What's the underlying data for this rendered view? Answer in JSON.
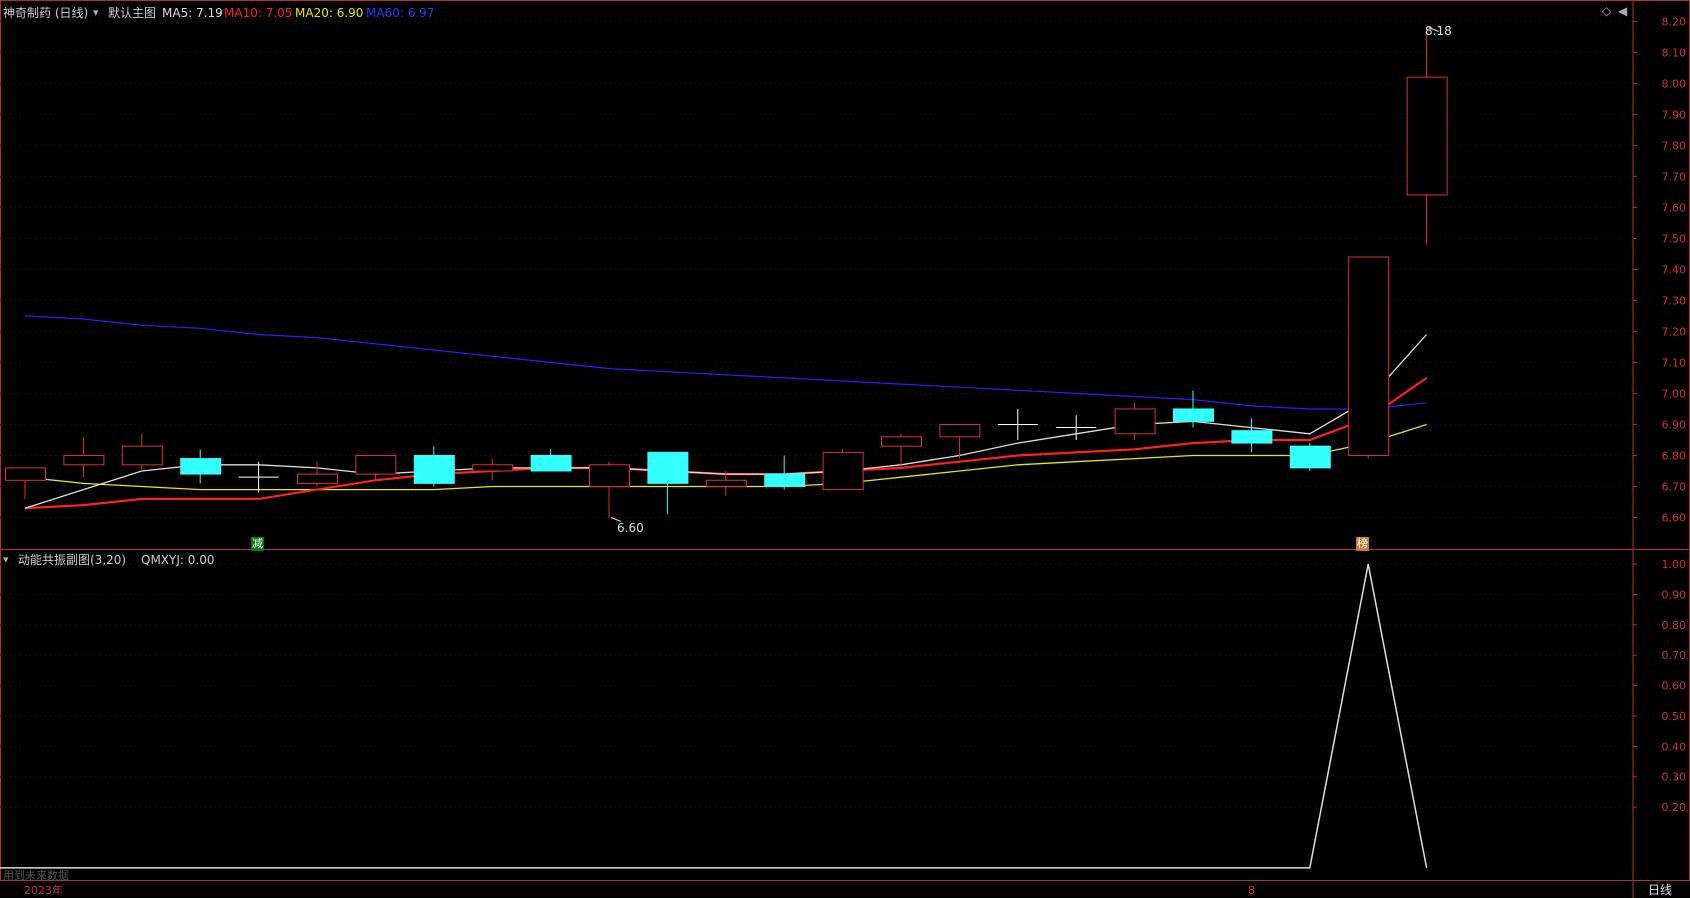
{
  "header": {
    "stock_name": "神奇制药 (日线)",
    "main_chart_label": "默认主图",
    "ma5": "MA5: 7.19",
    "ma10": "MA10: 7.05",
    "ma20": "MA20: 6.90",
    "ma60": "MA60: 6.97"
  },
  "sub_header": {
    "indicator": "动能共振副图(3,20)",
    "value": "QMXYJ: 0.00"
  },
  "footer": {
    "year": "2023年",
    "month": "8",
    "period": "日线",
    "note": "用到未来数据"
  },
  "markers": {
    "left": "减",
    "right": "榜"
  },
  "colors": {
    "up": "#e03030",
    "down": "#33ffff",
    "ma5": "#dddddd",
    "ma10": "#ff2020",
    "ma20": "#e8e800",
    "ma60": "#2222ff",
    "axis": "#b03030",
    "grid": "#550000"
  },
  "chart_data": [
    {
      "type": "candlestick",
      "title": "神奇制药 (日线)",
      "y_ticks": [
        6.6,
        6.7,
        6.8,
        6.9,
        7.0,
        7.1,
        7.2,
        7.3,
        7.4,
        7.5,
        7.6,
        7.7,
        7.8,
        7.9,
        8.0,
        8.1,
        8.2
      ],
      "ylim": [
        6.55,
        8.23
      ],
      "annotations": [
        {
          "text": "8.18",
          "value": 8.18,
          "index": 24
        },
        {
          "text": "6.60",
          "value": 6.6,
          "index": 10
        }
      ],
      "candles": [
        {
          "o": 6.72,
          "h": 6.76,
          "l": 6.66,
          "c": 6.76
        },
        {
          "o": 6.77,
          "h": 6.86,
          "l": 6.73,
          "c": 6.8
        },
        {
          "o": 6.77,
          "h": 6.87,
          "l": 6.75,
          "c": 6.83
        },
        {
          "o": 6.79,
          "h": 6.82,
          "l": 6.71,
          "c": 6.74
        },
        {
          "o": 6.73,
          "h": 6.78,
          "l": 6.68,
          "c": 6.73
        },
        {
          "o": 6.71,
          "h": 6.78,
          "l": 6.7,
          "c": 6.74
        },
        {
          "o": 6.74,
          "h": 6.8,
          "l": 6.72,
          "c": 6.8
        },
        {
          "o": 6.8,
          "h": 6.83,
          "l": 6.7,
          "c": 6.71
        },
        {
          "o": 6.75,
          "h": 6.79,
          "l": 6.72,
          "c": 6.77
        },
        {
          "o": 6.8,
          "h": 6.82,
          "l": 6.75,
          "c": 6.75
        },
        {
          "o": 6.7,
          "h": 6.78,
          "l": 6.6,
          "c": 6.77
        },
        {
          "o": 6.81,
          "h": 6.81,
          "l": 6.61,
          "c": 6.71
        },
        {
          "o": 6.7,
          "h": 6.75,
          "l": 6.67,
          "c": 6.72
        },
        {
          "o": 6.74,
          "h": 6.8,
          "l": 6.69,
          "c": 6.7
        },
        {
          "o": 6.69,
          "h": 6.82,
          "l": 6.69,
          "c": 6.81
        },
        {
          "o": 6.83,
          "h": 6.87,
          "l": 6.76,
          "c": 6.86
        },
        {
          "o": 6.86,
          "h": 6.9,
          "l": 6.79,
          "c": 6.9
        },
        {
          "o": 6.9,
          "h": 6.95,
          "l": 6.85,
          "c": 6.9
        },
        {
          "o": 6.89,
          "h": 6.93,
          "l": 6.85,
          "c": 6.89
        },
        {
          "o": 6.87,
          "h": 6.97,
          "l": 6.85,
          "c": 6.95
        },
        {
          "o": 6.95,
          "h": 7.01,
          "l": 6.89,
          "c": 6.91
        },
        {
          "o": 6.88,
          "h": 6.92,
          "l": 6.81,
          "c": 6.84
        },
        {
          "o": 6.83,
          "h": 6.84,
          "l": 6.75,
          "c": 6.76
        },
        {
          "o": 6.8,
          "h": 7.44,
          "l": 6.79,
          "c": 7.44
        },
        {
          "o": 7.64,
          "h": 8.18,
          "l": 7.48,
          "c": 8.02
        }
      ],
      "ma5": [
        6.63,
        6.69,
        6.75,
        6.77,
        6.77,
        6.76,
        6.74,
        6.75,
        6.76,
        6.76,
        6.76,
        6.75,
        6.74,
        6.74,
        6.75,
        6.77,
        6.8,
        6.84,
        6.87,
        6.9,
        6.91,
        6.89,
        6.87,
        6.98,
        7.19
      ],
      "ma10": [
        6.63,
        6.64,
        6.66,
        6.66,
        6.66,
        6.69,
        6.72,
        6.74,
        6.75,
        6.76,
        6.76,
        6.75,
        6.74,
        6.74,
        6.75,
        6.76,
        6.78,
        6.8,
        6.81,
        6.82,
        6.84,
        6.85,
        6.85,
        6.92,
        7.05
      ],
      "ma20": [
        6.73,
        6.71,
        6.7,
        6.69,
        6.69,
        6.69,
        6.69,
        6.69,
        6.7,
        6.7,
        6.7,
        6.7,
        6.7,
        6.7,
        6.71,
        6.73,
        6.75,
        6.77,
        6.78,
        6.79,
        6.8,
        6.8,
        6.8,
        6.84,
        6.9
      ],
      "ma60": [
        7.25,
        7.24,
        7.22,
        7.21,
        7.19,
        7.18,
        7.16,
        7.14,
        7.12,
        7.1,
        7.08,
        7.07,
        7.06,
        7.05,
        7.04,
        7.03,
        7.02,
        7.01,
        7.0,
        6.99,
        6.98,
        6.96,
        6.95,
        6.95,
        6.97
      ]
    },
    {
      "type": "line",
      "title": "动能共振副图(3,20)",
      "series": [
        {
          "name": "QMXYJ",
          "values": [
            0,
            0,
            0,
            0,
            0,
            0,
            0,
            0,
            0,
            0,
            0,
            0,
            0,
            0,
            0,
            0,
            0,
            0,
            0,
            0,
            0,
            0,
            0,
            1,
            0
          ]
        }
      ],
      "y_ticks": [
        0.2,
        0.3,
        0.4,
        0.5,
        0.6,
        0.7,
        0.8,
        0.9,
        1.0
      ],
      "ylim": [
        -0.04,
        1.03
      ]
    }
  ]
}
